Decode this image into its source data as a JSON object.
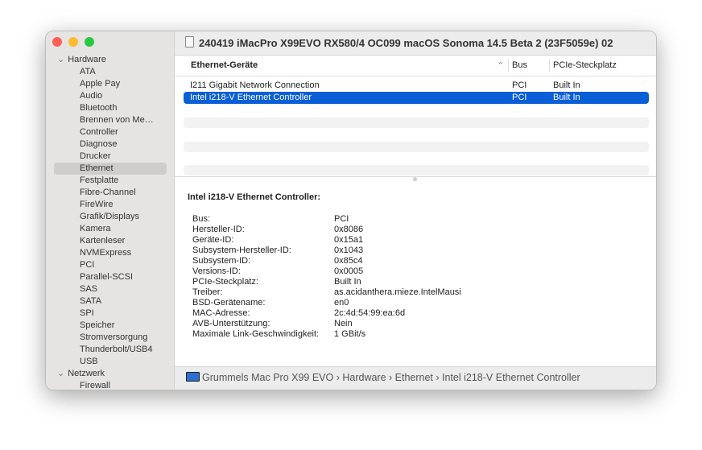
{
  "window": {
    "title": "240419 iMacPro X99EVO RX580/4 OC099 macOS Sonoma 14.5 Beta 2 (23F5059e) 02"
  },
  "sidebar": {
    "sections": [
      {
        "label": "Hardware",
        "items": [
          "ATA",
          "Apple Pay",
          "Audio",
          "Bluetooth",
          "Brennen von Me…",
          "Controller",
          "Diagnose",
          "Drucker",
          "Ethernet",
          "Festplatte",
          "Fibre-Channel",
          "FireWire",
          "Grafik/Displays",
          "Kamera",
          "Kartenleser",
          "NVMExpress",
          "PCI",
          "Parallel-SCSI",
          "SAS",
          "SATA",
          "SPI",
          "Speicher",
          "Stromversorgung",
          "Thunderbolt/USB4",
          "USB"
        ]
      },
      {
        "label": "Netzwerk",
        "items": [
          "Firewall"
        ]
      }
    ],
    "selected": "Ethernet"
  },
  "table": {
    "columns": [
      "Ethernet-Geräte",
      "Bus",
      "PCIe-Steckplatz"
    ],
    "rows": [
      [
        "I211 Gigabit Network Connection",
        "PCI",
        "Built In"
      ],
      [
        "Intel i218-V Ethernet Controller",
        "PCI",
        "Built In"
      ]
    ],
    "selected_index": 1
  },
  "detail": {
    "title": "Intel i218-V Ethernet Controller:",
    "fields": [
      [
        "Bus:",
        "PCI"
      ],
      [
        "Hersteller-ID:",
        "0x8086"
      ],
      [
        "Geräte-ID:",
        "0x15a1"
      ],
      [
        "Subsystem-Hersteller-ID:",
        "0x1043"
      ],
      [
        "Subsystem-ID:",
        "0x85c4"
      ],
      [
        "Versions-ID:",
        "0x0005"
      ],
      [
        "PCIe-Steckplatz:",
        "Built In"
      ],
      [
        "Treiber:",
        "as.acidanthera.mieze.IntelMausi"
      ],
      [
        "BSD-Gerätename:",
        "en0"
      ],
      [
        "MAC-Adresse:",
        "2c:4d:54:99:ea:6d"
      ],
      [
        "AVB-Unterstützung:",
        "Nein"
      ],
      [
        "Maximale Link-Geschwindigkeit:",
        "1 GBit/s"
      ]
    ]
  },
  "breadcrumb": [
    "Grummels Mac Pro X99 EVO",
    "Hardware",
    "Ethernet",
    "Intel i218-V Ethernet Controller"
  ],
  "colors": {
    "accent": "#0a5fd6"
  }
}
